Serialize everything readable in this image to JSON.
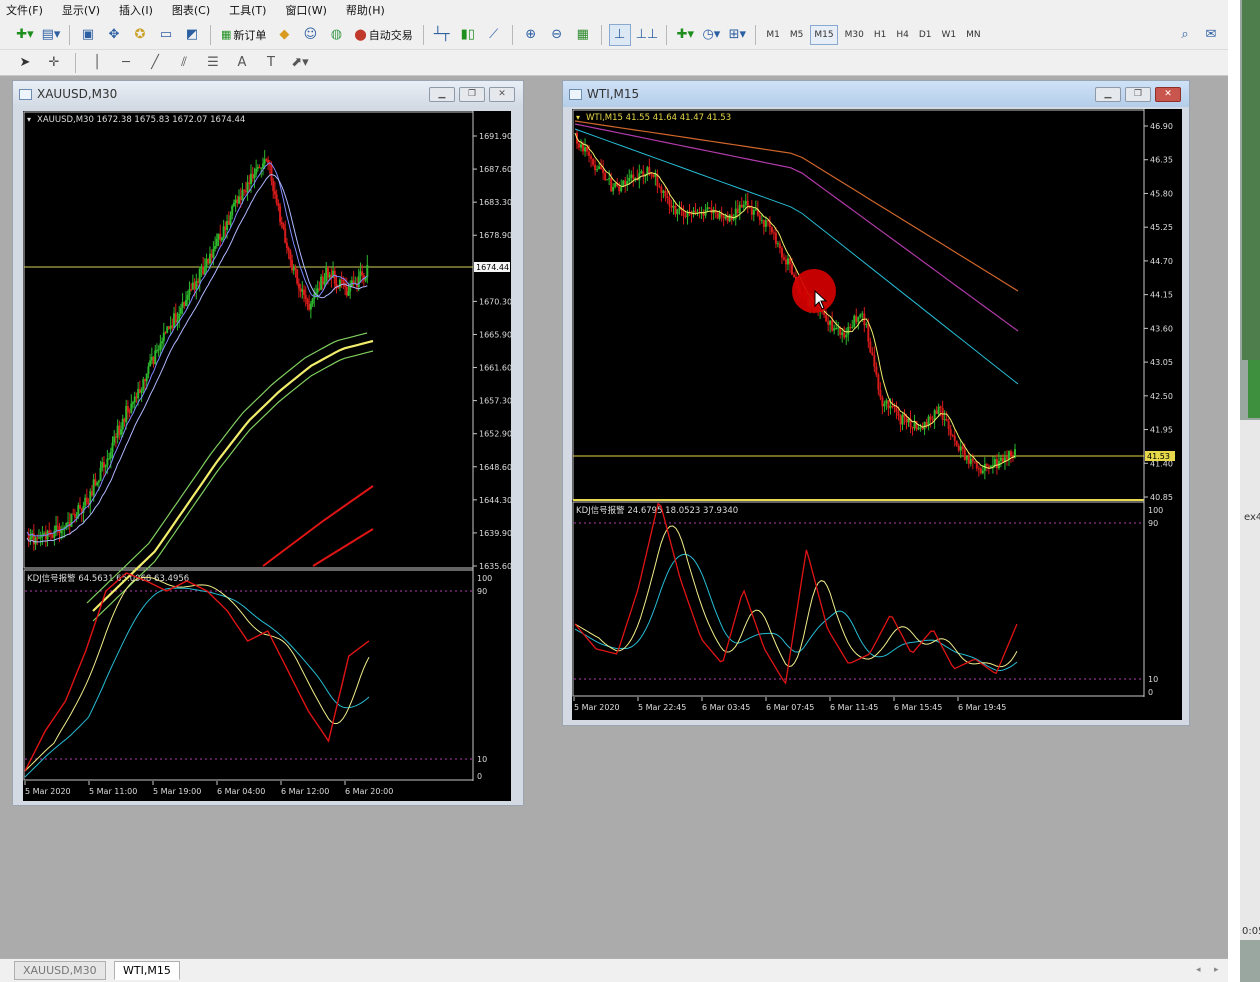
{
  "menu": {
    "items": [
      "文件(F)",
      "显示(V)",
      "插入(I)",
      "图表(C)",
      "工具(T)",
      "窗口(W)",
      "帮助(H)"
    ]
  },
  "toolbar": {
    "new_order": "新订单",
    "auto_trading": "自动交易",
    "timeframes": [
      "M1",
      "M5",
      "M15",
      "M30",
      "H1",
      "H4",
      "D1",
      "W1",
      "MN"
    ],
    "active_timeframe": "M15"
  },
  "drawing_tools": {
    "text_tool": "A",
    "label_tool": "T"
  },
  "windows": {
    "xau": {
      "title": "XAUUSD,M30",
      "header": "XAUUSD,M30  1672.38 1675.83 1672.07 1674.44",
      "price_axis": [
        "1691.90",
        "1687.60",
        "1683.30",
        "1678.90",
        "1674.44",
        "1670.30",
        "1665.90",
        "1661.60",
        "1657.30",
        "1652.90",
        "1648.60",
        "1644.30",
        "1639.90",
        "1635.60"
      ],
      "current_price": "1674.44",
      "kdj_header": "KDJ信号报警 64.5631 65.0968 63.4956",
      "kdj_axis": [
        "100",
        "90",
        "10",
        "0"
      ],
      "time_axis": [
        "5 Mar 2020",
        "5 Mar 11:00",
        "5 Mar 19:00",
        "6 Mar 04:00",
        "6 Mar 12:00",
        "6 Mar 20:00"
      ]
    },
    "wti": {
      "title": "WTI,M15",
      "header": "WTI,M15  41.55 41.64 41.47 41.53",
      "price_axis": [
        "46.90",
        "46.35",
        "45.80",
        "45.25",
        "44.70",
        "44.15",
        "43.60",
        "43.05",
        "42.50",
        "41.95",
        "41.40",
        "40.85"
      ],
      "current_price": "41.53",
      "kdj_header": "KDJ信号报警 24.6795 18.0523 37.9340",
      "kdj_axis": [
        "100",
        "90",
        "10",
        "0"
      ],
      "time_axis": [
        "5 Mar 2020",
        "5 Mar 22:45",
        "6 Mar 03:45",
        "6 Mar 07:45",
        "6 Mar 11:45",
        "6 Mar 15:45",
        "6 Mar 19:45"
      ]
    }
  },
  "window_tabs": [
    "XAUUSD,M30",
    "WTI,M15"
  ],
  "right_strip": {
    "text_top": "ex4",
    "text_bottom": "0:05"
  },
  "colors": {
    "bg": "#000000",
    "axis": "#c8c8c8",
    "bull": "#2db82d",
    "bear": "#d81b1b",
    "current_line": "#d4d45a",
    "kdj_k": "#e01414",
    "kdj_d": "#f2ee8a",
    "kdj_j": "#26bcd4",
    "level": "#b03aa8",
    "ma_gold": "#f2ee6c",
    "ma_green": "#7fcf5e",
    "ma_red": "#e01414",
    "ma_blue": "#8088ff",
    "ma_purple": "#b03aa8",
    "ma_orange": "#d0662a",
    "ma_cyan": "#26bcd4"
  }
}
